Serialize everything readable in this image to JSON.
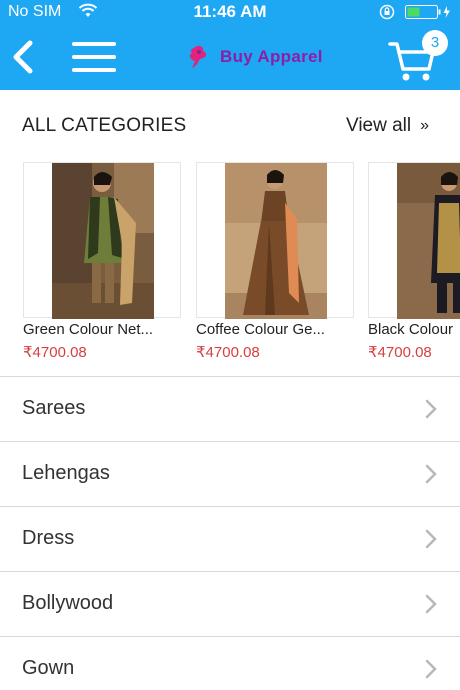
{
  "status_bar": {
    "carrier": "No SIM",
    "time": "11:46 AM",
    "icons": [
      "wifi-icon",
      "orientation-lock-icon",
      "battery-icon"
    ]
  },
  "nav_bar": {
    "background_color": "#1ea7f3",
    "brand_name": "Buy Apparel",
    "brand_color": "#8c1fa6",
    "cart_count": "3",
    "icons": [
      "back-arrow-icon",
      "hamburger-menu-icon",
      "brand-logo-icon",
      "cart-icon"
    ]
  },
  "categories_header": {
    "title": "ALL CATEGORIES",
    "view_all": "View all",
    "view_all_arrow": "»"
  },
  "products": [
    {
      "name": "Green Colour Net...",
      "price": "₹4700.08"
    },
    {
      "name": "Coffee Colour Ge...",
      "price": "₹4700.08"
    },
    {
      "name": "Black Colour",
      "price": "₹4700.08"
    }
  ],
  "price_color": "#d64040",
  "category_list": [
    {
      "label": "Sarees"
    },
    {
      "label": "Lehengas"
    },
    {
      "label": "Dress"
    },
    {
      "label": "Bollywood"
    },
    {
      "label": "Gown"
    }
  ]
}
